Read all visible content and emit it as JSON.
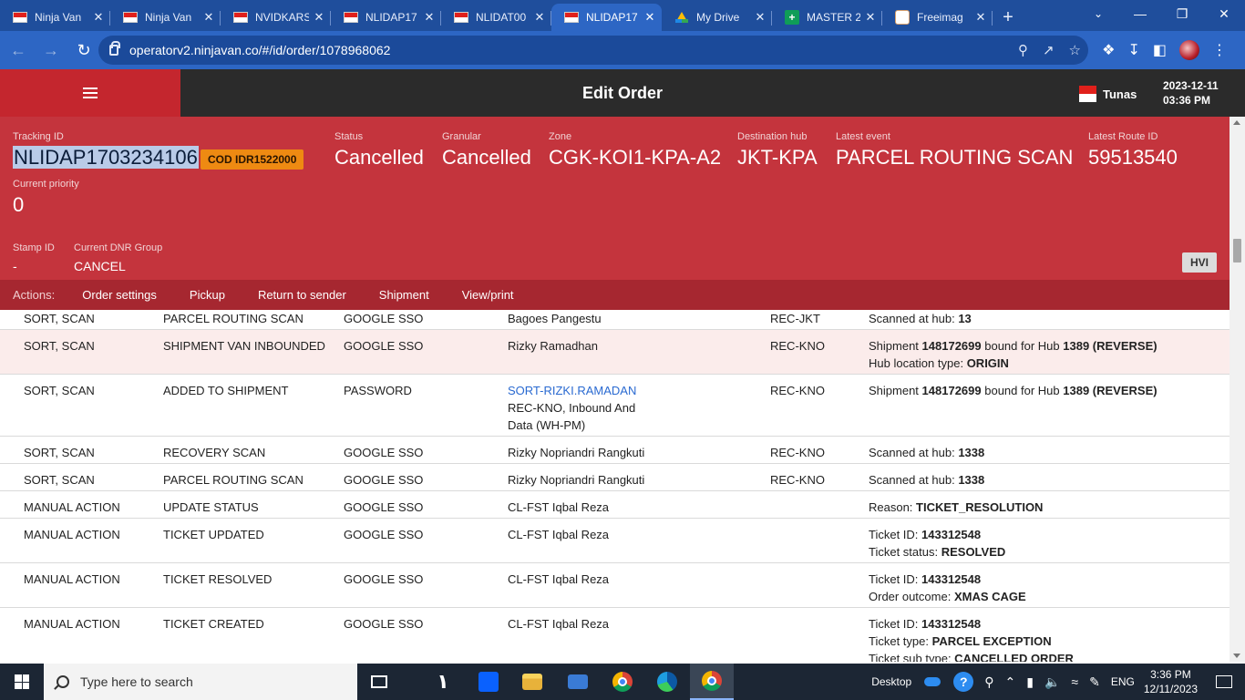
{
  "browser": {
    "tabs": [
      {
        "title": "Ninja Van",
        "favicon": "flag-favicon",
        "active": false
      },
      {
        "title": "Ninja Van",
        "favicon": "flag-favicon",
        "active": false
      },
      {
        "title": "NVIDKARS",
        "favicon": "flag-favicon",
        "active": false
      },
      {
        "title": "NLIDAP17",
        "favicon": "flag-favicon",
        "active": false
      },
      {
        "title": "NLIDAT00",
        "favicon": "flag-favicon",
        "active": false
      },
      {
        "title": "NLIDAP17",
        "favicon": "flag-favicon",
        "active": true
      },
      {
        "title": "My Drive",
        "favicon": "drive-favicon",
        "active": false
      },
      {
        "title": "MASTER 2",
        "favicon": "sheets-favicon",
        "active": false
      },
      {
        "title": "Freeimag",
        "favicon": "freeimage-favicon",
        "active": false
      }
    ],
    "new_tab": "+",
    "url": "operatorv2.ninjavan.co/#/id/order/1078968062",
    "colors": {
      "frame": "#1f4e9c",
      "toolbar": "#2d66c4",
      "omnibox": "#1b4a9a"
    }
  },
  "app": {
    "title": "Edit Order",
    "country": "Tunas",
    "date": "2023-12-11",
    "time": "03:36 PM",
    "brand_color": "#c4262e"
  },
  "order": {
    "tracking_id": {
      "label": "Tracking ID",
      "value": "NLIDAP1703234106"
    },
    "cod_badge": "COD IDR1522000",
    "status": {
      "label": "Status",
      "value": "Cancelled"
    },
    "granular": {
      "label": "Granular",
      "value": "Cancelled"
    },
    "zone": {
      "label": "Zone",
      "value": "CGK-KOI1-KPA-A2"
    },
    "destination_hub": {
      "label": "Destination hub",
      "value": "JKT-KPA"
    },
    "latest_event": {
      "label": "Latest event",
      "value": "PARCEL ROUTING SCAN"
    },
    "latest_route": {
      "label": "Latest Route ID",
      "value": "59513540"
    },
    "current_priority": {
      "label": "Current priority",
      "value": "0"
    },
    "stamp_id": {
      "label": "Stamp ID",
      "value": "-"
    },
    "dnr_group": {
      "label": "Current DNR Group",
      "value": "CANCEL"
    },
    "hvi_button": "HVI"
  },
  "actions": {
    "label": "Actions:",
    "items": [
      "Order settings",
      "Pickup",
      "Return to sender",
      "Shipment",
      "View/print"
    ]
  },
  "events": [
    {
      "type": "SORT, SCAN",
      "name": "PARCEL ROUTING SCAN",
      "source": "GOOGLE SSO",
      "user": [
        "Bagoes Pangestu"
      ],
      "hub": "REC-JKT",
      "desc": [
        [
          {
            "t": "Scanned at hub: "
          },
          {
            "t": "13",
            "b": true
          }
        ]
      ]
    },
    {
      "type": "SORT, SCAN",
      "name": "SHIPMENT VAN INBOUNDED",
      "source": "GOOGLE SSO",
      "user": [
        "Rizky Ramadhan"
      ],
      "hub": "REC-KNO",
      "hl": true,
      "desc": [
        [
          {
            "t": "Shipment "
          },
          {
            "t": "148172699",
            "b": true
          },
          {
            "t": " bound for Hub "
          },
          {
            "t": "1389 (REVERSE)",
            "b": true
          }
        ],
        [
          {
            "t": "Hub location type: "
          },
          {
            "t": "ORIGIN",
            "b": true
          }
        ]
      ]
    },
    {
      "type": "SORT, SCAN",
      "name": "ADDED TO SHIPMENT",
      "source": "PASSWORD",
      "user": [
        "SORT-RIZKI.RAMADAN",
        "REC-KNO, Inbound And",
        "Data (WH-PM)"
      ],
      "user_link": true,
      "hub": "REC-KNO",
      "desc": [
        [
          {
            "t": "Shipment "
          },
          {
            "t": "148172699",
            "b": true
          },
          {
            "t": " bound for Hub "
          },
          {
            "t": "1389 (REVERSE)",
            "b": true
          }
        ]
      ]
    },
    {
      "type": "SORT, SCAN",
      "name": "RECOVERY SCAN",
      "source": "GOOGLE SSO",
      "user": [
        "Rizky Nopriandri Rangkuti"
      ],
      "hub": "REC-KNO",
      "desc": [
        [
          {
            "t": "Scanned at hub: "
          },
          {
            "t": "1338",
            "b": true
          }
        ]
      ]
    },
    {
      "type": "SORT, SCAN",
      "name": "PARCEL ROUTING SCAN",
      "source": "GOOGLE SSO",
      "user": [
        "Rizky Nopriandri Rangkuti"
      ],
      "hub": "REC-KNO",
      "desc": [
        [
          {
            "t": "Scanned at hub: "
          },
          {
            "t": "1338",
            "b": true
          }
        ]
      ]
    },
    {
      "type": "MANUAL ACTION",
      "name": "UPDATE STATUS",
      "source": "GOOGLE SSO",
      "user": [
        "CL-FST Iqbal Reza"
      ],
      "hub": "",
      "desc": [
        [
          {
            "t": "Reason: "
          },
          {
            "t": "TICKET_RESOLUTION",
            "b": true
          }
        ]
      ]
    },
    {
      "type": "MANUAL ACTION",
      "name": "TICKET UPDATED",
      "source": "GOOGLE SSO",
      "user": [
        "CL-FST Iqbal Reza"
      ],
      "hub": "",
      "desc": [
        [
          {
            "t": "Ticket ID: "
          },
          {
            "t": "143312548",
            "b": true
          }
        ],
        [
          {
            "t": "Ticket status: "
          },
          {
            "t": "RESOLVED",
            "b": true
          }
        ]
      ]
    },
    {
      "type": "MANUAL ACTION",
      "name": "TICKET RESOLVED",
      "source": "GOOGLE SSO",
      "user": [
        "CL-FST Iqbal Reza"
      ],
      "hub": "",
      "desc": [
        [
          {
            "t": "Ticket ID: "
          },
          {
            "t": "143312548",
            "b": true
          }
        ],
        [
          {
            "t": "Order outcome: "
          },
          {
            "t": "XMAS CAGE",
            "b": true
          }
        ]
      ]
    },
    {
      "type": "MANUAL ACTION",
      "name": "TICKET CREATED",
      "source": "GOOGLE SSO",
      "user": [
        "CL-FST Iqbal Reza"
      ],
      "hub": "",
      "desc": [
        [
          {
            "t": "Ticket ID: "
          },
          {
            "t": "143312548",
            "b": true
          }
        ],
        [
          {
            "t": "Ticket type: "
          },
          {
            "t": "PARCEL EXCEPTION",
            "b": true
          }
        ],
        [
          {
            "t": "Ticket sub type: "
          },
          {
            "t": "CANCELLED ORDER",
            "b": true
          }
        ]
      ]
    }
  ],
  "taskbar": {
    "search_placeholder": "Type here to search",
    "desktop_label": "Desktop",
    "language": "ENG",
    "time": "3:36 PM",
    "date": "12/11/2023"
  }
}
